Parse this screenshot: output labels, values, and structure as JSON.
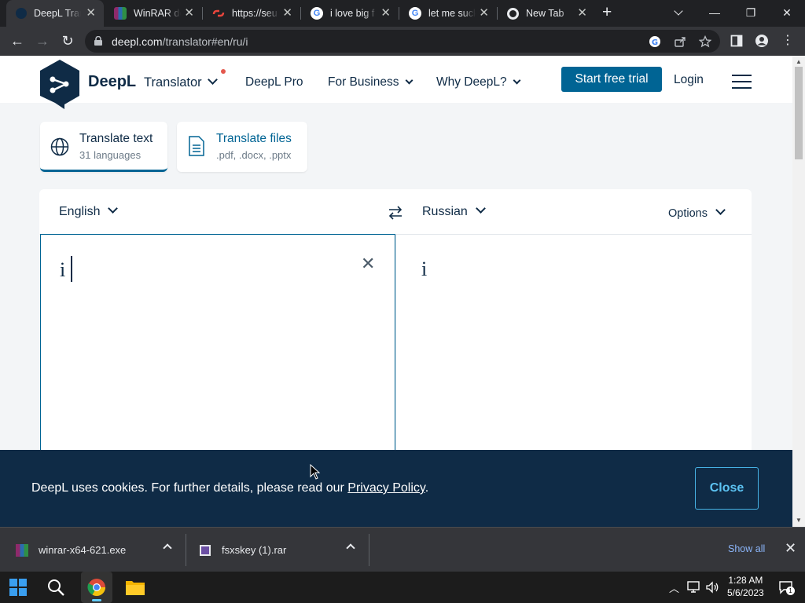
{
  "browser": {
    "tabs": [
      {
        "title": "DeepL Translate",
        "favicon": "deepl-icon",
        "active": true
      },
      {
        "title": "WinRAR download",
        "favicon": "winrar-icon",
        "active": false
      },
      {
        "title": "https://seu",
        "favicon": "link-icon",
        "active": false
      },
      {
        "title": "i love big f",
        "favicon": "google-icon",
        "active": false
      },
      {
        "title": "let me suck",
        "favicon": "google-icon",
        "active": false
      },
      {
        "title": "New Tab",
        "favicon": "chrome-icon",
        "active": false
      }
    ],
    "url_host": "deepl.com",
    "url_path": "/translator#en/ru/i"
  },
  "site": {
    "brand": "DeepL",
    "brand_sub": "Translator",
    "nav": [
      "DeepL Pro",
      "For Business",
      "Why DeepL?"
    ],
    "cta": "Start free trial",
    "login": "Login"
  },
  "modes": [
    {
      "title": "Translate text",
      "subtitle": "31 languages",
      "icon": "globe-icon"
    },
    {
      "title": "Translate files",
      "subtitle": ".pdf, .docx, .pptx",
      "icon": "document-icon"
    }
  ],
  "translator": {
    "source_lang": "English",
    "target_lang": "Russian",
    "options_label": "Options",
    "source_text": "i",
    "target_text": "i"
  },
  "cookie": {
    "message_prefix": "DeepL uses cookies. For further details, please read our ",
    "link_text": "Privacy Policy",
    "message_suffix": ".",
    "close_label": "Close"
  },
  "downloads": {
    "items": [
      {
        "name": "winrar-x64-621.exe",
        "icon": "winrar-icon"
      },
      {
        "name": "fsxskey (1).rar",
        "icon": "rar-archive-icon"
      }
    ],
    "show_all": "Show all"
  },
  "taskbar": {
    "time": "1:28 AM",
    "date": "5/6/2023",
    "notification_count": "1"
  }
}
